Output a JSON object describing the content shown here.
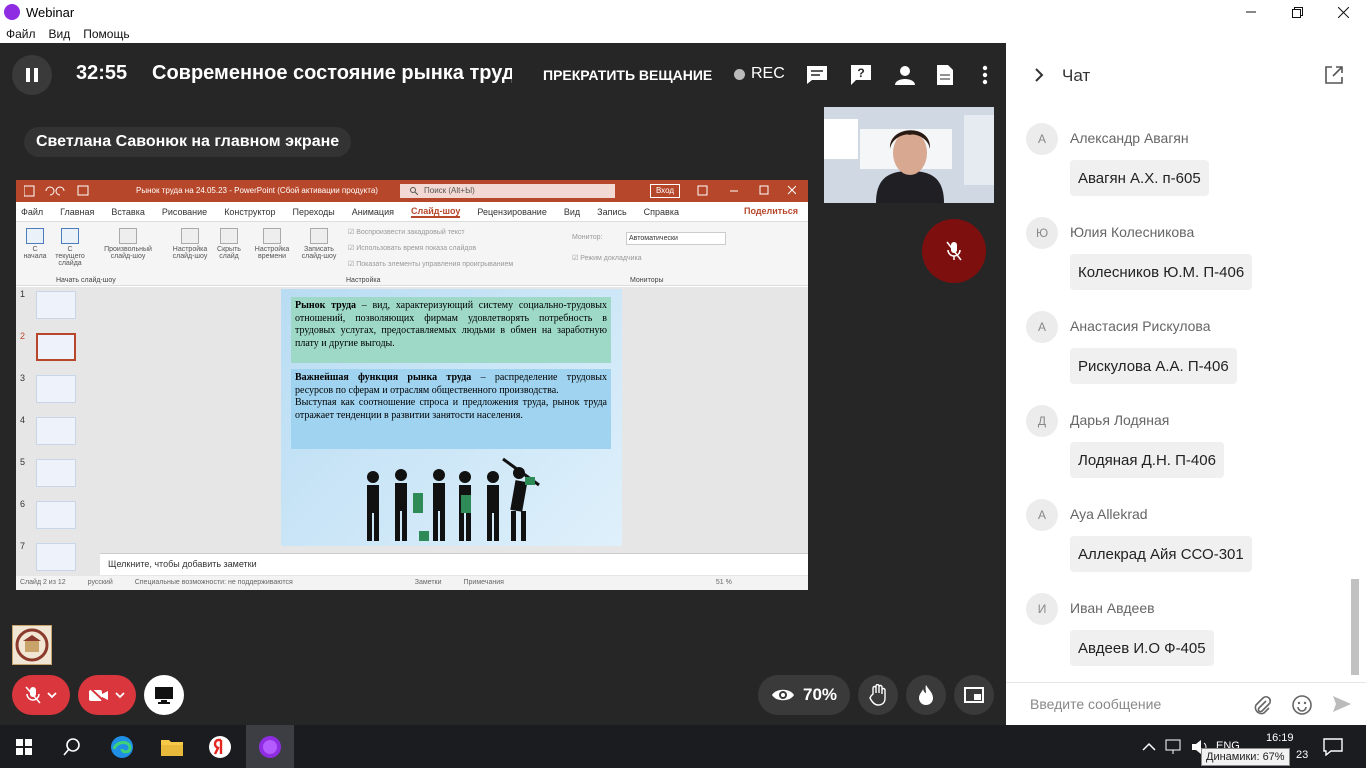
{
  "window": {
    "title": "Webinar",
    "menu": [
      "Файл",
      "Вид",
      "Помощь"
    ]
  },
  "topbar": {
    "timer": "32:55",
    "event_title": "Современное состояние рынка труд",
    "stop_button": "ПРЕКРАТИТЬ ВЕЩАНИЕ",
    "rec_label": "REC"
  },
  "screen_label": "Светлана Савонюк на главном экране",
  "powerpoint": {
    "doc_title": "Рынок труда на 24.05.23 - PowerPoint (Сбой активации продукта)",
    "search_placeholder": "Поиск (Alt+Ы)",
    "login_label": "Вход",
    "tabs": [
      "Файл",
      "Главная",
      "Вставка",
      "Рисование",
      "Конструктор",
      "Переходы",
      "Анимация",
      "Слайд-шоу",
      "Рецензирование",
      "Вид",
      "Запись",
      "Справка"
    ],
    "active_tab": "Слайд-шоу",
    "share_label": "Поделиться",
    "ribbon": {
      "from_start": "С начала",
      "from_current": "С текущего слайда",
      "custom": "Произвольный слайд-шоу",
      "setup": "Настройка слайд-шоу",
      "hide": "Скрыть слайд",
      "rehearse": "Настройка времени",
      "record": "Записать слайд-шоу",
      "checks": [
        "Воспроизвести закадровый текст",
        "Использовать время показа слайдов",
        "Показать элементы управления проигрыванием"
      ],
      "monitor_label": "Монитор:",
      "monitor_value": "Автоматически",
      "presenter_view": "Режим докладчика",
      "groups": [
        "Начать слайд-шоу",
        "Настройка",
        "Мониторы"
      ]
    },
    "slide_numbers": [
      "1",
      "2",
      "3",
      "4",
      "5",
      "6",
      "7"
    ],
    "active_slide": "2",
    "slide": {
      "block1_bold": "Рынок труда",
      "block1_rest": " – вид, характеризующий систему социально-трудовых отношений, позволяющих фирмам удовлетворять потребность в трудовых услугах, предоставляемых людьми в обмен на заработную плату и другие выгоды.",
      "block2_bold": "Важнейшая функция рынка труда",
      "block2_rest": " – распределение трудовых ресурсов по сферам и отраслям общественного производства.",
      "block2_para2": "Выступая как соотношение спроса и предложения труда, рынок труда отражает тенденции в развитии занятости населения."
    },
    "notes_placeholder": "Щелкните, чтобы добавить заметки",
    "status": {
      "slide_info": "Слайд 2 из 12",
      "lang": "русский",
      "accessibility": "Специальные возможности: не поддерживаются",
      "notes": "Заметки",
      "comments": "Примечания",
      "zoom": "51 %"
    }
  },
  "views": "70%",
  "chat": {
    "title": "Чат",
    "input_placeholder": "Введите сообщение",
    "messages": [
      {
        "initial": "А",
        "author": "Александр Авагян",
        "text": "Авагян А.Х. п-605"
      },
      {
        "initial": "Ю",
        "author": "Юлия Колесникова",
        "text": "Колесников Ю.М. П-406"
      },
      {
        "initial": "А",
        "author": "Анастасия Рискулова",
        "text": "Рискулова А.А. П-406"
      },
      {
        "initial": "Д",
        "author": "Дарья Лодяная",
        "text": "Лодяная Д.Н. П-406"
      },
      {
        "initial": "А",
        "author": "Aya Allekrad",
        "text": "Аллекрад Айя ССО-301"
      },
      {
        "initial": "И",
        "author": "Иван Авдеев",
        "text": "Авдеев И.О Ф-405"
      }
    ]
  },
  "taskbar": {
    "lang": "ENG",
    "time": "16:19",
    "date_fragment": "23",
    "tooltip": "Динамики: 67%"
  },
  "colors": {
    "accent_purple": "#8e2de2",
    "ppt_red": "#b7472a",
    "mute_red": "#d9363e"
  }
}
